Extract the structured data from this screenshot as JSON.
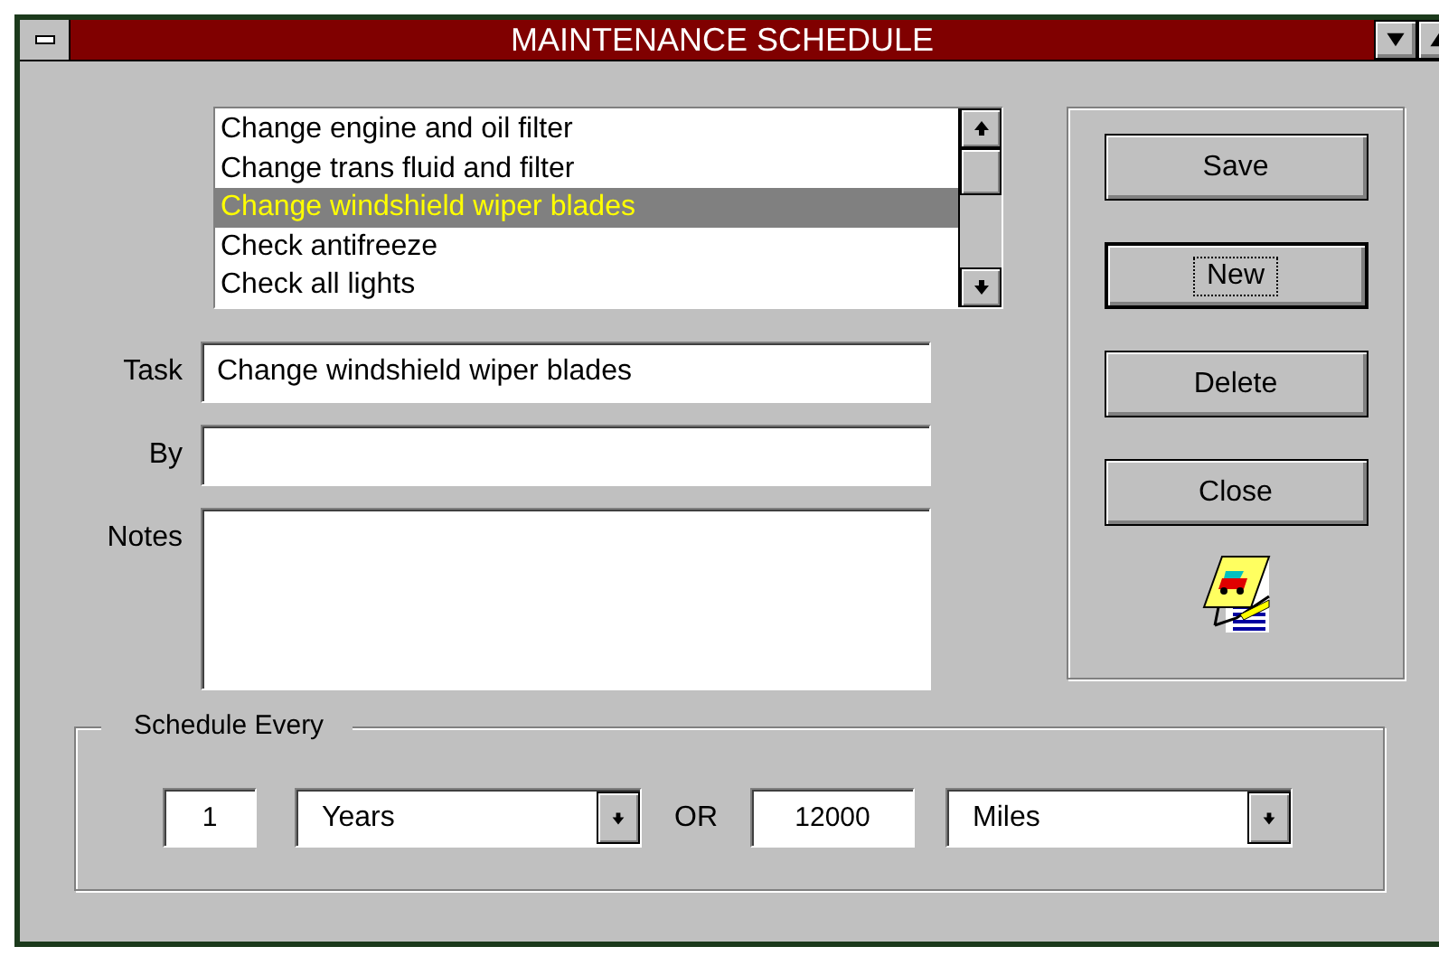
{
  "window": {
    "title": "MAINTENANCE SCHEDULE"
  },
  "tasks": [
    {
      "label": "Change engine and oil filter",
      "selected": false
    },
    {
      "label": "Change trans fluid and filter",
      "selected": false
    },
    {
      "label": "Change windshield wiper blades",
      "selected": true
    },
    {
      "label": "Check antifreeze",
      "selected": false
    },
    {
      "label": "Check all lights",
      "selected": false
    }
  ],
  "fields": [
    {
      "label": "Task",
      "value": "Change windshield wiper blades",
      "kind": "line"
    },
    {
      "label": "By",
      "kind": "line"
    },
    {
      "label": "Notes",
      "kind": "area"
    }
  ],
  "buttons": [
    {
      "label": "Save",
      "focused": false
    },
    {
      "label": "New",
      "focused": true
    },
    {
      "label": "Delete",
      "focused": false
    },
    {
      "label": "Close",
      "focused": false
    }
  ],
  "schedule": {
    "title": "Schedule Every",
    "interval": "1",
    "unit": "Years",
    "separator": "OR",
    "distance": "12000",
    "distance_unit": "Miles"
  }
}
